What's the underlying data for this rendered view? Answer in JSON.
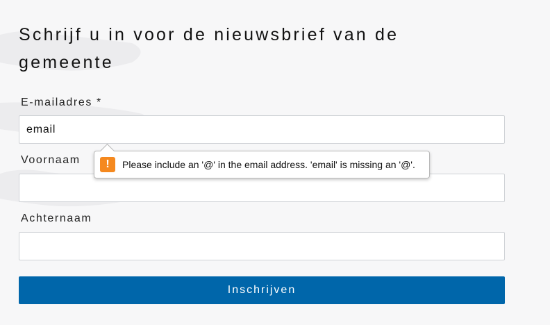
{
  "form": {
    "title": "Schrijf u in voor de nieuwsbrief van de gemeente",
    "email_label": "E-mailadres",
    "required_marker": "*",
    "email_value": "email",
    "first_name_label": "Voornaam",
    "first_name_value": "",
    "last_name_label": "Achternaam",
    "last_name_value": "",
    "submit_label": "Inschrijven"
  },
  "validation_tooltip": {
    "icon": "warning-icon",
    "glyph": "!",
    "message": "Please include an '@' in the email address. 'email' is missing an '@'."
  },
  "colors": {
    "background": "#f7f7f8",
    "submit_button": "#0066aa",
    "warning": "#f5891f"
  }
}
